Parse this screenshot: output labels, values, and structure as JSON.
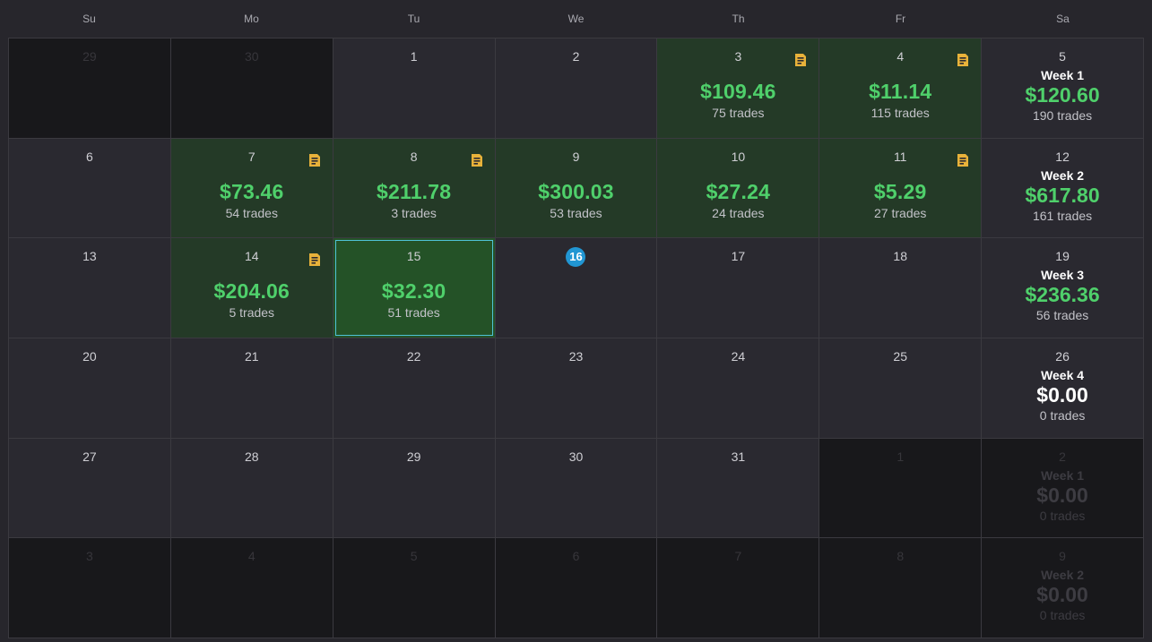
{
  "weekdays": [
    "Su",
    "Mo",
    "Tu",
    "We",
    "Th",
    "Fr",
    "Sa"
  ],
  "colors": {
    "profit": "#4fd06b",
    "today": "#2196d3",
    "note": "#e8b23a",
    "selected_border": "#4fc3d6"
  },
  "weeks": [
    {
      "days": [
        {
          "day": "29",
          "outside": true
        },
        {
          "day": "30",
          "outside": true
        },
        {
          "day": "1"
        },
        {
          "day": "2"
        },
        {
          "day": "3",
          "pnl": "$109.46",
          "trades": "75 trades",
          "note": true
        },
        {
          "day": "4",
          "pnl": "$11.14",
          "trades": "115 trades",
          "note": true
        }
      ],
      "summary": {
        "day": "5",
        "label": "Week 1",
        "pnl": "$120.60",
        "trades": "190 trades"
      }
    },
    {
      "days": [
        {
          "day": "6"
        },
        {
          "day": "7",
          "pnl": "$73.46",
          "trades": "54 trades",
          "note": true
        },
        {
          "day": "8",
          "pnl": "$211.78",
          "trades": "3 trades",
          "note": true
        },
        {
          "day": "9",
          "pnl": "$300.03",
          "trades": "53 trades"
        },
        {
          "day": "10",
          "pnl": "$27.24",
          "trades": "24 trades"
        },
        {
          "day": "11",
          "pnl": "$5.29",
          "trades": "27 trades",
          "note": true
        }
      ],
      "summary": {
        "day": "12",
        "label": "Week 2",
        "pnl": "$617.80",
        "trades": "161 trades"
      }
    },
    {
      "days": [
        {
          "day": "13"
        },
        {
          "day": "14",
          "pnl": "$204.06",
          "trades": "5 trades",
          "note": true
        },
        {
          "day": "15",
          "pnl": "$32.30",
          "trades": "51 trades",
          "selected": true
        },
        {
          "day": "16",
          "today": true
        },
        {
          "day": "17"
        },
        {
          "day": "18"
        }
      ],
      "summary": {
        "day": "19",
        "label": "Week 3",
        "pnl": "$236.36",
        "trades": "56 trades"
      }
    },
    {
      "days": [
        {
          "day": "20"
        },
        {
          "day": "21"
        },
        {
          "day": "22"
        },
        {
          "day": "23"
        },
        {
          "day": "24"
        },
        {
          "day": "25"
        }
      ],
      "summary": {
        "day": "26",
        "label": "Week 4",
        "pnl": "$0.00",
        "trades": "0 trades",
        "zero": true
      }
    },
    {
      "days": [
        {
          "day": "27"
        },
        {
          "day": "28"
        },
        {
          "day": "29"
        },
        {
          "day": "30"
        },
        {
          "day": "31"
        },
        {
          "day": "1",
          "outside": true
        }
      ],
      "summary": {
        "day": "2",
        "label": "Week 1",
        "pnl": "$0.00",
        "trades": "0 trades",
        "zero": true,
        "outside": true
      }
    },
    {
      "days": [
        {
          "day": "3",
          "outside": true
        },
        {
          "day": "4",
          "outside": true
        },
        {
          "day": "5",
          "outside": true
        },
        {
          "day": "6",
          "outside": true
        },
        {
          "day": "7",
          "outside": true
        },
        {
          "day": "8",
          "outside": true
        }
      ],
      "summary": {
        "day": "9",
        "label": "Week 2",
        "pnl": "$0.00",
        "trades": "0 trades",
        "zero": true,
        "outside": true
      }
    }
  ]
}
